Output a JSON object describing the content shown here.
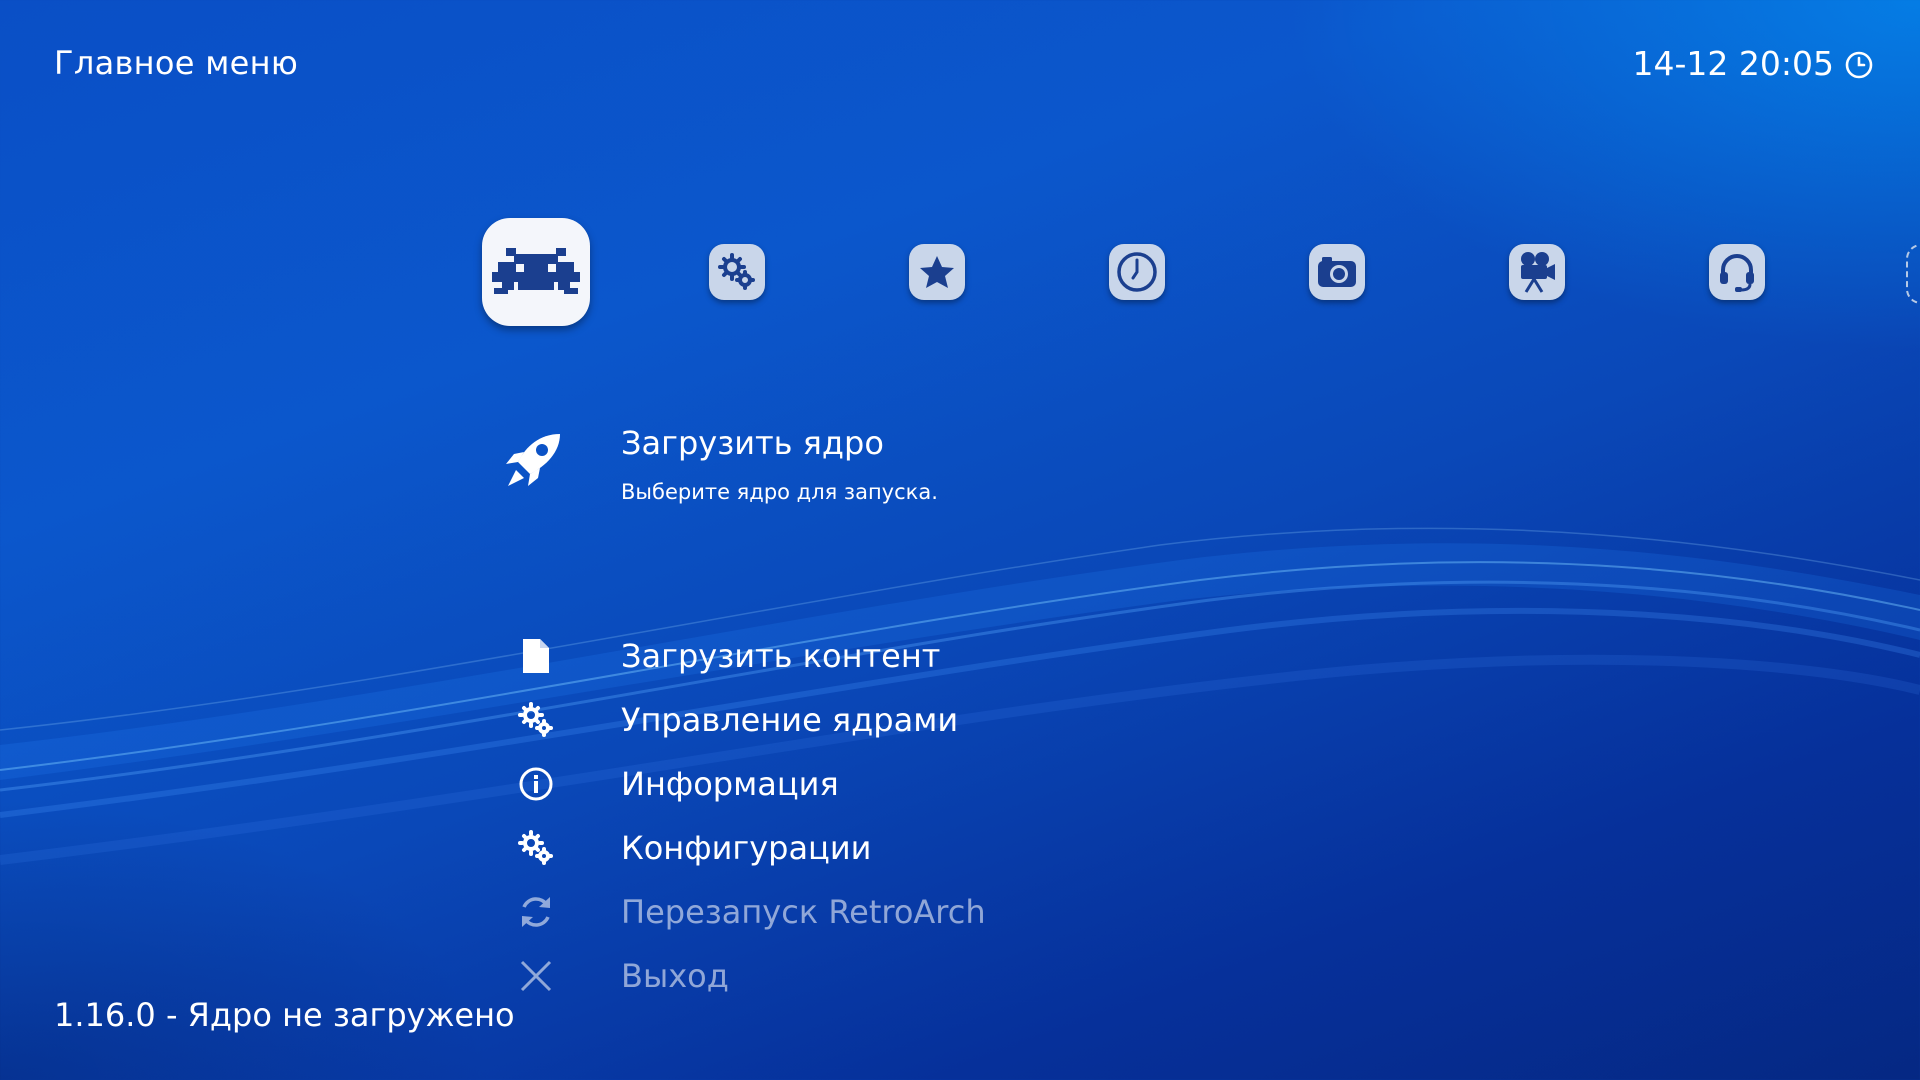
{
  "header": {
    "title": "Главное меню"
  },
  "clock": {
    "text": "14-12 20:05",
    "icon": "clock-icon"
  },
  "tabs": [
    {
      "name": "main-menu",
      "icon": "retroarch-invader-icon",
      "active": true
    },
    {
      "name": "settings",
      "icon": "settings-gears-icon",
      "active": false
    },
    {
      "name": "favorites",
      "icon": "star-icon",
      "active": false
    },
    {
      "name": "history",
      "icon": "history-clock-icon",
      "active": false
    },
    {
      "name": "images",
      "icon": "camera-icon",
      "active": false
    },
    {
      "name": "video",
      "icon": "movie-camera-icon",
      "active": false
    },
    {
      "name": "netplay",
      "icon": "headset-icon",
      "active": false
    },
    {
      "name": "add",
      "icon": "plus-icon",
      "active": false
    }
  ],
  "selected": {
    "label": "Загрузить ядро",
    "sublabel": "Выберите ядро для запуска.",
    "icon": "rocket-icon"
  },
  "menu": {
    "items": [
      {
        "label": "Загрузить контент",
        "icon": "file-icon"
      },
      {
        "label": "Управление ядрами",
        "icon": "gears-icon"
      },
      {
        "label": "Информация",
        "icon": "info-icon"
      },
      {
        "label": "Конфигурации",
        "icon": "gears-icon"
      },
      {
        "label": "Перезапуск RetroArch",
        "icon": "restart-icon"
      },
      {
        "label": "Выход",
        "icon": "close-icon"
      }
    ]
  },
  "footer": {
    "version": "1.16.0 - Ядро не загружено"
  },
  "colors": {
    "background_top": "#0a4fc6",
    "background_bottom": "#052883",
    "tab_active": "#f4f6fb",
    "tab_inactive": "#c9d6ea",
    "icon_glyph": "#1b3f8f"
  }
}
